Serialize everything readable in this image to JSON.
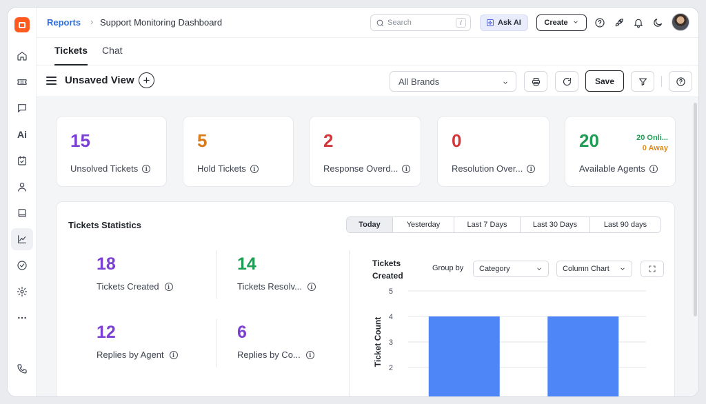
{
  "breadcrumb": {
    "parent": "Reports",
    "separator": "›",
    "current": "Support Monitoring Dashboard"
  },
  "header": {
    "search_placeholder": "Search",
    "search_shortcut": "/",
    "ask_ai_label": "Ask AI",
    "create_label": "Create"
  },
  "tabs": [
    {
      "label": "Tickets",
      "active": true
    },
    {
      "label": "Chat",
      "active": false
    }
  ],
  "view": {
    "title": "Unsaved View",
    "brand_filter": "All Brands",
    "save_label": "Save"
  },
  "sidebar": {
    "ai_label": "Ai",
    "icons": [
      "home-icon",
      "ticket-icon",
      "chat-icon",
      "ai-icon",
      "calendar-check-icon",
      "user-icon",
      "book-icon",
      "reports-chart-icon",
      "check-circle-icon",
      "settings-icon",
      "more-icon",
      "phone-icon"
    ]
  },
  "stats": [
    {
      "value": "15",
      "label": "Unsolved Tickets",
      "color": "#7b3fd4"
    },
    {
      "value": "5",
      "label": "Hold Tickets",
      "color": "#d97a1a"
    },
    {
      "value": "2",
      "label": "Response Overd...",
      "color": "#d1373b"
    },
    {
      "value": "0",
      "label": "Resolution Over...",
      "color": "#d1373b"
    },
    {
      "value": "20",
      "label": "Available Agents",
      "color": "#1f9d55"
    }
  ],
  "agents": {
    "online": "20 Onli...",
    "away": "0 Away",
    "online_color": "#1f9d55",
    "away_color": "#e08a12"
  },
  "statistics": {
    "title": "Tickets Statistics",
    "ranges": [
      {
        "label": "Today",
        "active": true
      },
      {
        "label": "Yesterday",
        "active": false
      },
      {
        "label": "Last 7 Days",
        "active": false
      },
      {
        "label": "Last 30 Days",
        "active": false
      },
      {
        "label": "Last 90 days",
        "active": false
      }
    ],
    "metrics": [
      {
        "value": "18",
        "label": "Tickets Created",
        "color": "#7b3fd4"
      },
      {
        "value": "14",
        "label": "Tickets Resolv...",
        "color": "#1f9d55"
      },
      {
        "value": "12",
        "label": "Replies by Agent",
        "color": "#7b3fd4"
      },
      {
        "value": "6",
        "label": "Replies by Co...",
        "color": "#7b3fd4"
      }
    ]
  },
  "chart_panel": {
    "title_line1": "Tickets",
    "title_line2": "Created",
    "group_by_label": "Group by",
    "group_by_value": "Category",
    "chart_type_value": "Column Chart"
  },
  "chart_data": {
    "type": "bar",
    "categories": [
      "",
      ""
    ],
    "values": [
      4,
      4
    ],
    "title": "Tickets Created",
    "xlabel": "",
    "ylabel": "Ticket Count",
    "ylim": [
      0,
      5
    ],
    "yticks": [
      2,
      3,
      4,
      5
    ],
    "bar_color": "#4f86f7",
    "grid": true
  }
}
